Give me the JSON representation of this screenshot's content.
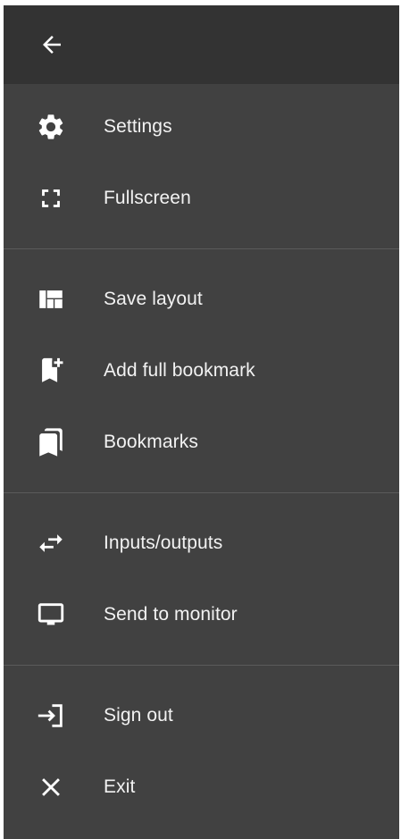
{
  "header": {
    "back_icon": "arrow-left-icon"
  },
  "menu": {
    "groups": [
      {
        "items": [
          {
            "label": "Settings",
            "icon": "gear-icon"
          },
          {
            "label": "Fullscreen",
            "icon": "fullscreen-icon"
          }
        ]
      },
      {
        "items": [
          {
            "label": "Save layout",
            "icon": "layout-icon"
          },
          {
            "label": "Add full bookmark",
            "icon": "bookmark-add-icon"
          },
          {
            "label": "Bookmarks",
            "icon": "bookmarks-icon"
          }
        ]
      },
      {
        "items": [
          {
            "label": "Inputs/outputs",
            "icon": "swap-arrows-icon"
          },
          {
            "label": "Send to monitor",
            "icon": "monitor-icon"
          }
        ]
      },
      {
        "items": [
          {
            "label": "Sign out",
            "icon": "sign-out-icon"
          },
          {
            "label": "Exit",
            "icon": "close-icon"
          }
        ]
      }
    ]
  },
  "colors": {
    "panel_bg": "#414141",
    "header_bg": "#333333",
    "divider": "#5a5a5a",
    "text": "#f2f2f2",
    "icon": "#ffffff"
  }
}
